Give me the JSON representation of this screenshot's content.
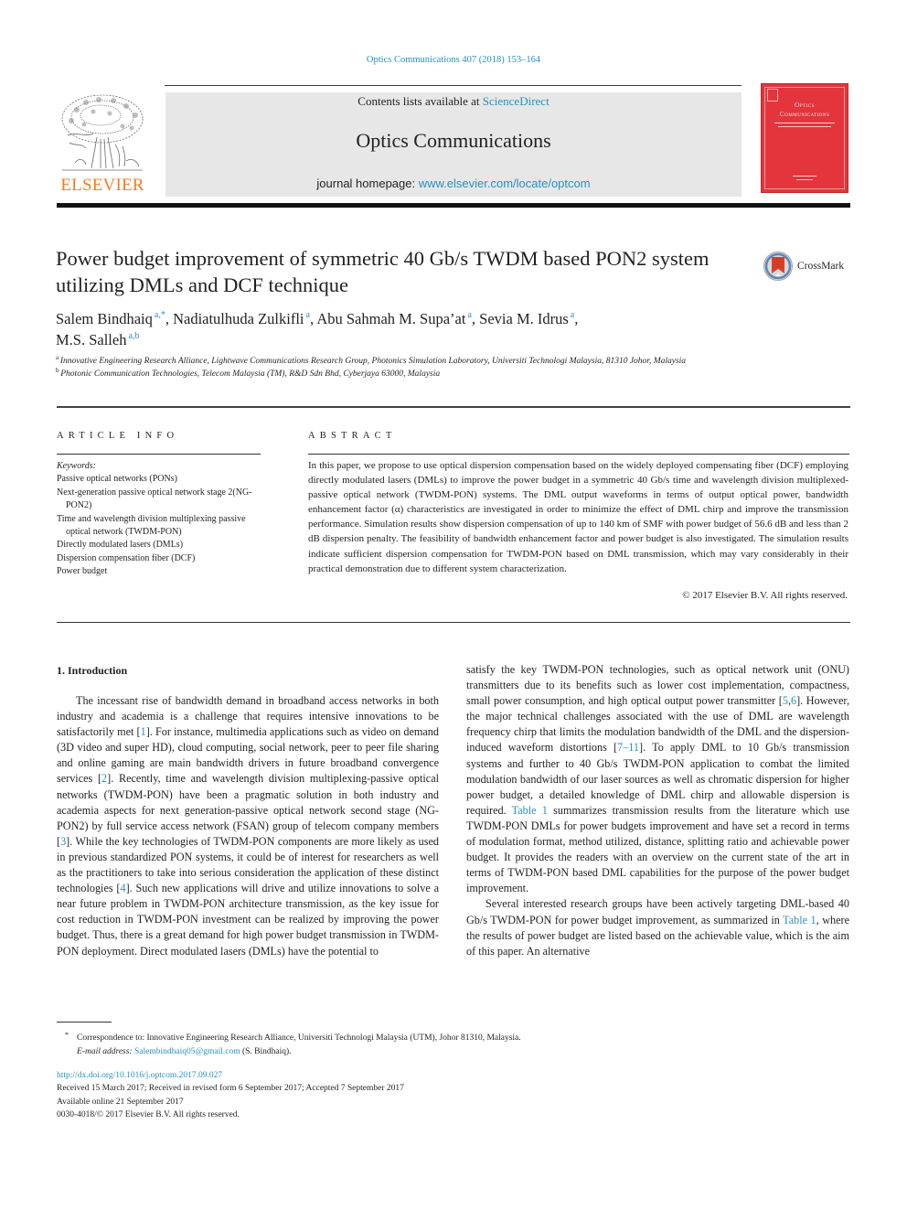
{
  "citation": "Optics Communications 407 (2018) 153–164",
  "header": {
    "publisher_logo_text": "ELSEVIER",
    "contents_prefix": "Contents lists available at ",
    "contents_link": "ScienceDirect",
    "journal_title": "Optics Communications",
    "homepage_prefix": "journal homepage: ",
    "homepage_link": "www.elsevier.com/locate/optcom",
    "cover_title_line1": "Optics",
    "cover_title_line2": "Communications",
    "colors": {
      "logo_orange": "#f47b20",
      "cover_red": "#e3353b",
      "link_blue": "#2a8fbd",
      "banner_gray": "#e7e7e7"
    }
  },
  "article": {
    "title": "Power budget improvement of symmetric 40 Gb/s TWDM based PON2 system utilizing DMLs and DCF technique",
    "crossmark_label": "CrossMark",
    "authors": [
      {
        "name": "Salem Bindhaiq",
        "sup": "a,*",
        "sep": ", "
      },
      {
        "name": "Nadiatulhuda Zulkifli",
        "sup": "a",
        "sep": ", "
      },
      {
        "name": "Abu Sahmah M. Supa’at",
        "sup": "a",
        "sep": ", "
      },
      {
        "name": "Sevia M. Idrus",
        "sup": "a",
        "sep": ","
      },
      {
        "name": "M.S. Salleh",
        "sup": "a,b",
        "sep": ""
      }
    ],
    "affiliations": [
      {
        "label": "a",
        "text": "Innovative Engineering Research Alliance, Lightwave Communications Research Group, Photonics Simulation Laboratory, Universiti Technologi Malaysia, 81310 Johor, Malaysia"
      },
      {
        "label": "b",
        "text": "Photonic Communication Technologies, Telecom Malaysia (TM), R&D Sdn Bhd, Cyberjaya 63000, Malaysia"
      }
    ]
  },
  "article_info": {
    "heading": "ARTICLE INFO",
    "keywords_label": "Keywords:",
    "keywords": [
      "Passive optical networks (PONs)",
      "Next-generation passive optical network stage 2(NG-PON2)",
      "Time and wavelength division multiplexing passive optical network (TWDM-PON)",
      "Directly modulated lasers (DMLs)",
      "Dispersion compensation fiber (DCF)",
      "Power budget"
    ]
  },
  "abstract": {
    "heading": "ABSTRACT",
    "text": "In this paper, we propose to use optical dispersion compensation based on the widely deployed compensating fiber (DCF) employing directly modulated lasers (DMLs) to improve the power budget in a symmetric 40 Gb/s time and wavelength division multiplexed-passive optical network (TWDM-PON) systems. The DML output waveforms in terms of output optical power, bandwidth enhancement factor (α) characteristics are investigated in order to minimize the effect of DML chirp and improve the transmission performance. Simulation results show dispersion compensation of up to 140 km of SMF with power budget of 56.6 dB and less than 2 dB dispersion penalty. The feasibility of bandwidth enhancement factor and power budget is also investigated. The simulation results indicate sufficient dispersion compensation for TWDM-PON based on DML transmission, which may vary considerably in their practical demonstration due to different system characterization.",
    "copyright": "© 2017 Elsevier B.V. All rights reserved."
  },
  "body": {
    "section_heading": "1.  Introduction",
    "left_paragraphs": [
      [
        {
          "t": "The incessant rise of bandwidth demand in broadband access networks in both industry and academia is a challenge that requires intensive innovations to be satisfactorily met ["
        },
        {
          "t": "1",
          "link": true
        },
        {
          "t": "]. For instance, multimedia applications such as video on demand (3D video and super HD), cloud computing, social network, peer to peer file sharing and online gaming are main bandwidth drivers in future broadband convergence services ["
        },
        {
          "t": "2",
          "link": true
        },
        {
          "t": "]. Recently, time and wavelength division multiplexing-passive optical networks (TWDM-PON) have been a pragmatic solution in both industry and academia aspects for next generation-passive optical network second stage (NG-PON2) by full service access network (FSAN) group of telecom company members ["
        },
        {
          "t": "3",
          "link": true
        },
        {
          "t": "]. While the key technologies of TWDM-PON components are more likely as used in previous standardized PON systems, it could be of interest for researchers as well as the practitioners to take into serious consideration the application of these distinct technologies ["
        },
        {
          "t": "4",
          "link": true
        },
        {
          "t": "]. Such new applications will drive and utilize innovations to solve a near future problem in TWDM-PON architecture transmission, as the key issue for cost reduction in TWDM-PON investment can be realized by improving the power budget. Thus, there is a great demand for high power budget transmission in TWDM-PON deployment. Direct modulated lasers (DMLs) have the potential to"
        }
      ]
    ],
    "right_paragraphs": [
      [
        {
          "t": "satisfy the key TWDM-PON technologies, such as optical network unit (ONU) transmitters due to its benefits such as lower cost implementation, compactness, small power consumption, and high optical output power transmitter ["
        },
        {
          "t": "5",
          "link": true
        },
        {
          "t": ","
        },
        {
          "t": "6",
          "link": true
        },
        {
          "t": "]. However, the major technical challenges associated with the use of DML are wavelength frequency chirp that limits the modulation bandwidth of the DML and the dispersion-induced waveform distortions ["
        },
        {
          "t": "7–11",
          "link": true
        },
        {
          "t": "]. To apply DML to 10 Gb/s transmission systems and further to 40 Gb/s TWDM-PON application to combat the limited modulation bandwidth of our laser sources as well as chromatic dispersion for higher power budget, a detailed knowledge of DML chirp and allowable dispersion is required. "
        },
        {
          "t": "Table 1",
          "link": true
        },
        {
          "t": " summarizes transmission results from the literature which use TWDM-PON DMLs for power budgets improvement and have set a record in terms of modulation format, method utilized, distance, splitting ratio and achievable power budget. It provides the readers with an overview on the current state of the art in terms of TWDM-PON based DML capabilities for the purpose of the power budget improvement."
        }
      ],
      [
        {
          "t": "Several interested research groups have been actively targeting DML-based 40 Gb/s TWDM-PON for power budget improvement, as summarized in "
        },
        {
          "t": "Table 1",
          "link": true
        },
        {
          "t": ", where the results of power budget are listed based on the achievable value, which is the aim of this paper. An alternative"
        }
      ]
    ]
  },
  "footnotes": {
    "star": "*",
    "correspondence": "Correspondence to: Innovative Engineering Research Alliance, Universiti Technologi Malaysia (UTM), Johor 81310, Malaysia.",
    "email_label": "E-mail address: ",
    "email": "Salembindhaiq05@gmail.com",
    "email_suffix": " (S. Bindhaiq)."
  },
  "pubinfo": {
    "doi": "http://dx.doi.org/10.1016/j.optcom.2017.09.027",
    "received": "Received 15 March 2017; Received in revised form 6 September 2017; Accepted 7 September 2017",
    "available": "Available online 21 September 2017",
    "issn": "0030-4018/© 2017 Elsevier B.V. All rights reserved."
  }
}
